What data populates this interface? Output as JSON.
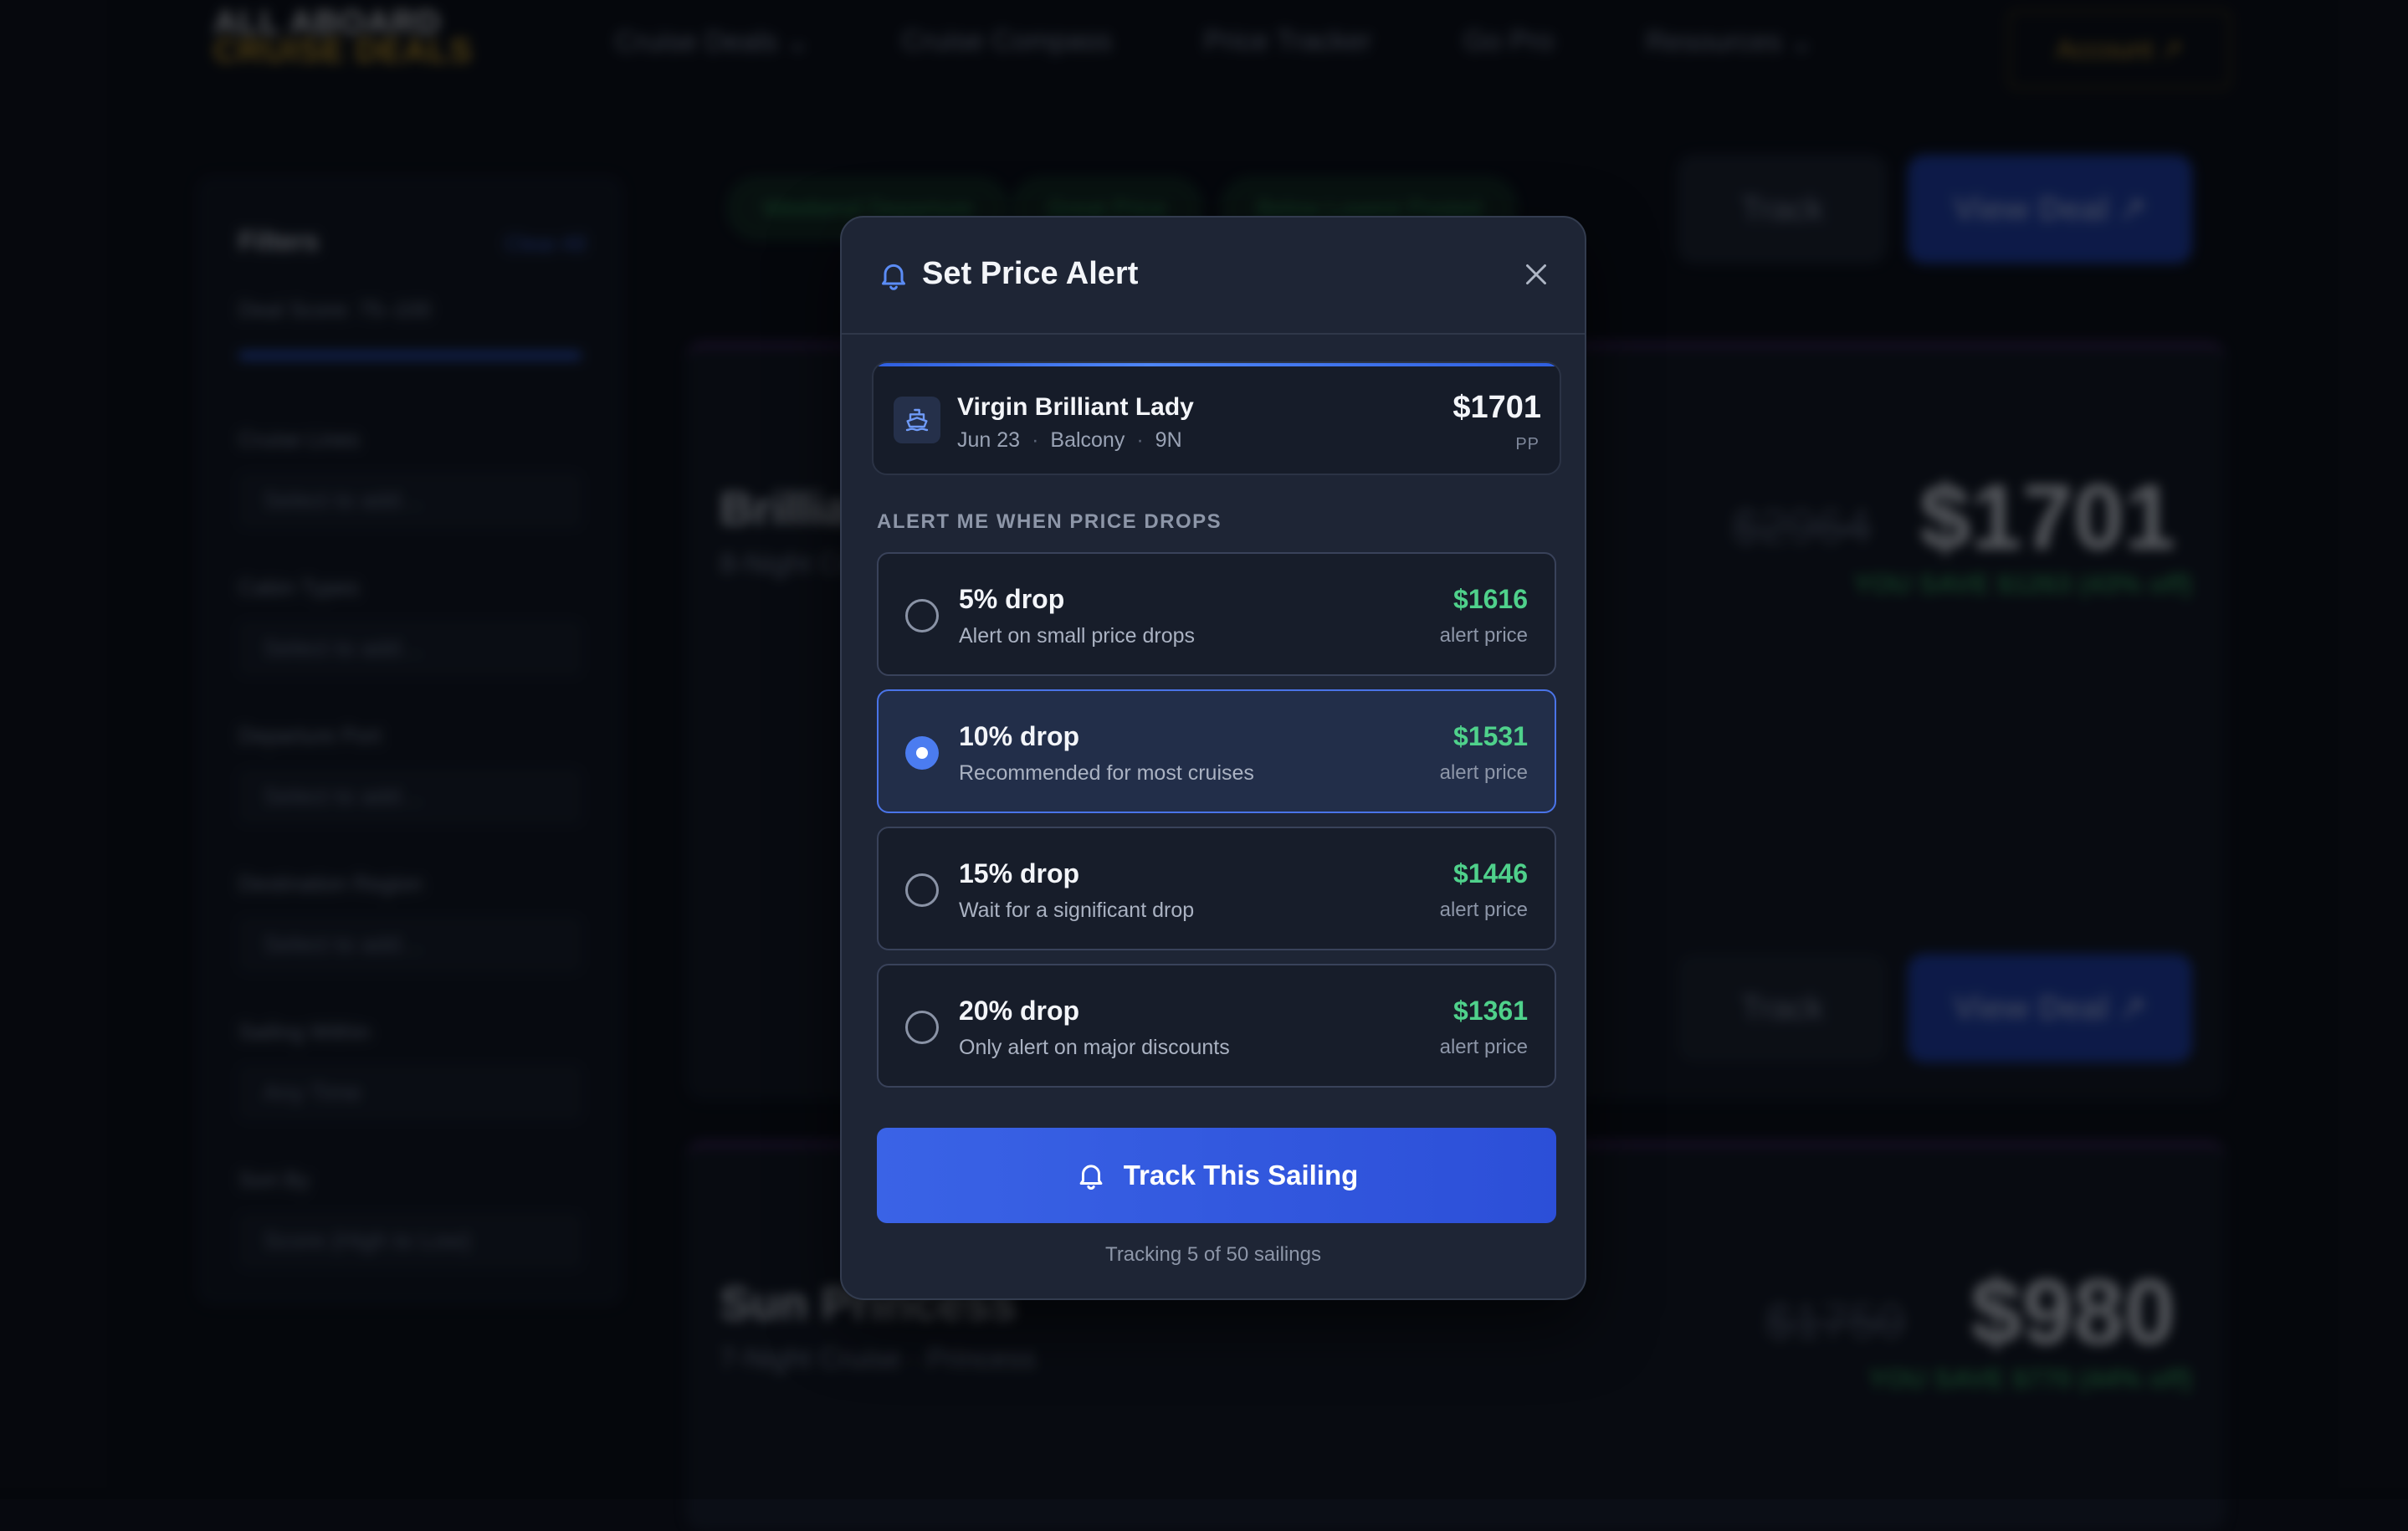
{
  "background": {
    "logo_line1": "ALL ABOARD",
    "logo_line2": "CRUISE DEALS",
    "nav": [
      "Cruise Deals ⌄",
      "Cruise Compass",
      "Price Tracker",
      "Go Pro",
      "Resources ⌄"
    ],
    "account": "Account ↗",
    "filters": {
      "title": "Filters",
      "clear": "Clear All",
      "deal_score": "Deal Score: 75–100",
      "labels": [
        "Cruise Lines",
        "Cabin Types",
        "Departure Port",
        "Destination Region",
        "Sailing Within",
        "Sort By"
      ],
      "selects": [
        "Select to add…",
        "Select to add…",
        "Select to add…",
        "Select to add…",
        "Any Time",
        "Score (High to Low)"
      ]
    },
    "pills": [
      "Weekend Departure",
      "Great Price",
      "Below Lowest Posted"
    ],
    "track_label": "Track",
    "view_label": "View Deal ↗",
    "card1": {
      "title": "Brilliant Lady",
      "subtitle": "8-Night Cruise",
      "old_price": "$2964",
      "price": "$1701",
      "save": "YOU SAVE $1263 (43% off)"
    },
    "card2": {
      "title": "Sun Princess",
      "subtitle": "7-Night Cruise · Princess",
      "old_price": "$1750",
      "price": "$980",
      "save": "YOU SAVE $770 (44% off)"
    }
  },
  "modal": {
    "title": "Set Price Alert",
    "ship": {
      "name": "Virgin Brilliant Lady",
      "date": "Jun 23",
      "cabin": "Balcony",
      "nights": "9N",
      "price": "$1701",
      "price_unit": "PP"
    },
    "section_label": "ALERT ME WHEN PRICE DROPS",
    "options": [
      {
        "title": "5% drop",
        "desc": "Alert on small price drops",
        "price": "$1616",
        "price_label": "alert price"
      },
      {
        "title": "10% drop",
        "desc": "Recommended for most cruises",
        "price": "$1531",
        "price_label": "alert price"
      },
      {
        "title": "15% drop",
        "desc": "Wait for a significant drop",
        "price": "$1446",
        "price_label": "alert price"
      },
      {
        "title": "20% drop",
        "desc": "Only alert on major discounts",
        "price": "$1361",
        "price_label": "alert price"
      }
    ],
    "selected_option": "10% drop",
    "button_label": "Track This Sailing",
    "footer": "Tracking 5 of 50 sailings",
    "colors": {
      "accent": "#4b7cf0",
      "button": "#3a63e6",
      "price_green": "#4fd18b",
      "surface": "#1e2535"
    }
  }
}
